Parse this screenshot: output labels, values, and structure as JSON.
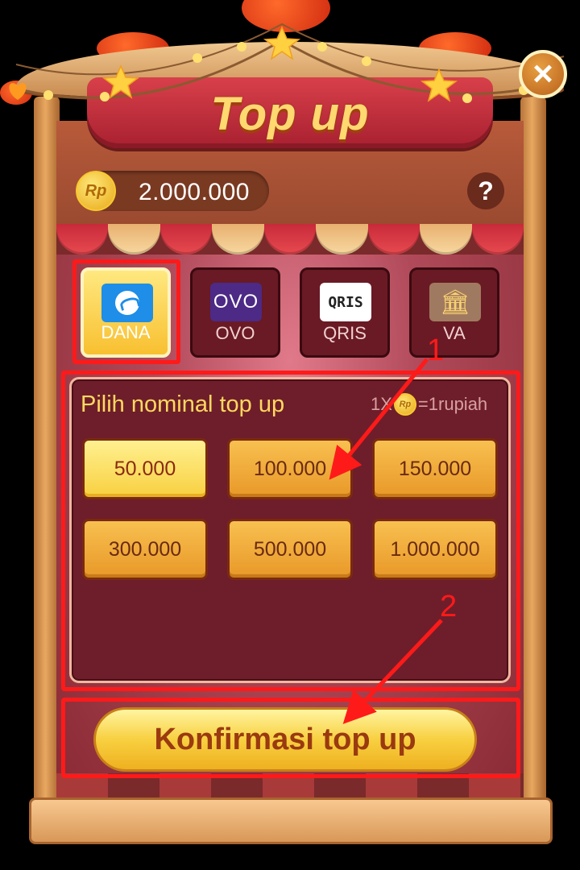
{
  "dialog": {
    "title": "Top up",
    "close_label": "×",
    "help_label": "?"
  },
  "balance": {
    "currency_badge": "Rp",
    "amount": "2.000.000"
  },
  "payment_methods": [
    {
      "label": "DANA",
      "icon": "dana-icon",
      "selected": true
    },
    {
      "label": "OVO",
      "icon_text": "OVO",
      "icon": "ovo-icon",
      "selected": false
    },
    {
      "label": "QRIS",
      "icon_text": "QRIS",
      "icon": "qris-icon",
      "selected": false
    },
    {
      "label": "VA",
      "icon": "bank-icon",
      "selected": false
    }
  ],
  "nominal": {
    "title": "Pilih nominal top up",
    "rate_prefix": "1X",
    "rate_coin": "Rp",
    "rate_suffix": "=1rupiah",
    "options": [
      "50.000",
      "100.000",
      "150.000",
      "300.000",
      "500.000",
      "1.000.000"
    ],
    "selected": "50.000"
  },
  "confirm_label": "Konfirmasi top up",
  "annotations": {
    "step1": "1",
    "step2": "2"
  },
  "colors": {
    "highlight": "#ff1a1a",
    "accent_gold": "#ffd860",
    "panel": "#6e1e2a"
  }
}
